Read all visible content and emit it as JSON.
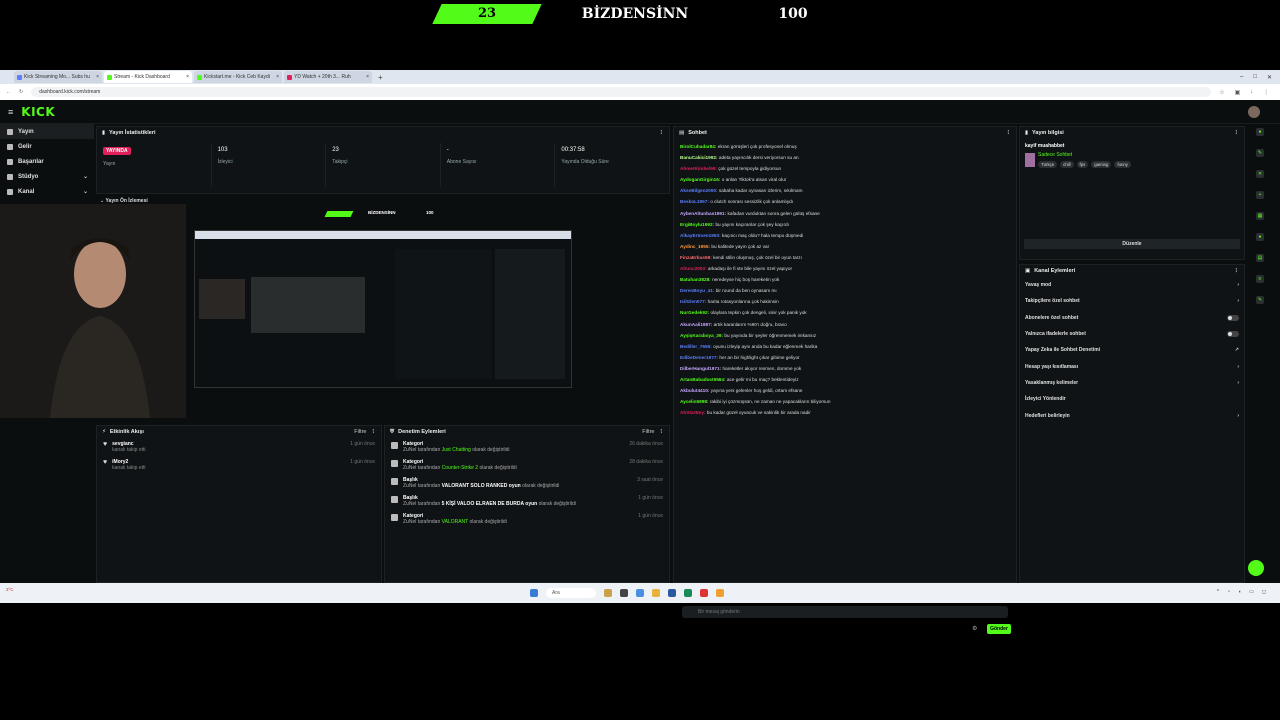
{
  "overlay": {
    "score": "23",
    "title": "BİZDENSİNN",
    "right_value": "100"
  },
  "browser": {
    "tabs": [
      {
        "label": "Kick Streaming Mo... Subs hu",
        "active": false
      },
      {
        "label": "Stream - Kick Dashboard",
        "active": true
      },
      {
        "label": "Kickstart.me - Kick Ceb Kaydi",
        "active": false
      },
      {
        "label": "YD Watch + 20th 3... Ruh",
        "active": false
      }
    ],
    "url": "dashboard.kick.com/stream"
  },
  "app": {
    "logo": "KICK",
    "sidebar": [
      {
        "label": "Yayın",
        "active": true,
        "chevron": false
      },
      {
        "label": "Gelir",
        "active": false,
        "chevron": false
      },
      {
        "label": "Başarılar",
        "active": false,
        "chevron": false
      },
      {
        "label": "Stüdyo",
        "active": false,
        "chevron": true
      },
      {
        "label": "Kanal",
        "active": false,
        "chevron": true
      }
    ],
    "stats": {
      "title": "Yayın İstatistikleri",
      "items": [
        {
          "value": "YAYINDA",
          "label": "Yayın",
          "badge": true
        },
        {
          "value": "103",
          "label": "İzleyici",
          "badge": false
        },
        {
          "value": "23",
          "label": "Takipçi",
          "badge": false
        },
        {
          "value": "-",
          "label": "Abone Sayısı",
          "badge": false
        },
        {
          "value": "00:37:58",
          "label": "Yayında Olduğu Süre",
          "badge": false
        }
      ]
    },
    "preview": {
      "title": "Yayın Ön İzlemesi",
      "mini_score": "",
      "mini_title": "BİZDENSİNN",
      "mini_right": "100"
    },
    "activity": {
      "title": "Etkinlik Akışı",
      "filter": "Filtre",
      "items": [
        {
          "name": "sevgianc",
          "sub": "kanalı takip etti",
          "time": "1 gün önce"
        },
        {
          "name": "iMory2",
          "sub": "kanalı takip etti",
          "time": "1 gün önce"
        }
      ]
    },
    "moderation": {
      "title": "Denetim Eylemleri",
      "filter": "Filtre",
      "items": [
        {
          "type": "Kategori",
          "pre": "ZuNel tarafından",
          "value": "Just Chatting",
          "post": "olarak değiştirildi",
          "time": "26 dakika önce"
        },
        {
          "type": "Kategori",
          "pre": "ZuNel tarafından",
          "value": "Counter-Strike 2",
          "post": "olarak değiştirildi",
          "time": "28 dakika önce"
        },
        {
          "type": "Başlık",
          "pre": "ZuNel tarafından",
          "value": "VALORANT SOLO RANKED oyun",
          "post": "olarak değiştirildi",
          "time": "3 saat önce"
        },
        {
          "type": "Başlık",
          "pre": "ZuNel tarafından",
          "value": "5 KİŞİ VALOO ELRAEN DE BURDA oyun",
          "post": "olarak değiştirildi",
          "time": "1 gün önce"
        },
        {
          "type": "Kategori",
          "pre": "ZuNel tarafından",
          "value": "VALORANT",
          "post": "olarak değiştirildi",
          "time": "1 gün önce"
        }
      ]
    },
    "chat": {
      "title": "Sohbet",
      "placeholder": "Bir mesaj gönderin",
      "send": "Gönder",
      "messages": [
        {
          "user": "BirolCuhadar84:",
          "text": "ekran görüşleri çok profesyonel olmuş",
          "color": "#53fc18"
        },
        {
          "user": "BanuCakici1992:",
          "text": "adeta yayıncılık dersi veriyorsun su an",
          "color": "#b6ff8a"
        },
        {
          "user": "AhmetKimbel99:",
          "text": "çok güzel tempoyla gidiyorsun",
          "color": "#e0205a"
        },
        {
          "user": "AydoganGirgin16:",
          "text": "o anları Tiktok'a atsan viral olur",
          "color": "#53fc18"
        },
        {
          "user": "AkseBilgen2000:",
          "text": "sabaha kadar oynasan izlerim, sıkılmam",
          "color": "#5b7fff"
        },
        {
          "user": "BeskoL1957:",
          "text": "o clutch sonrası sessizlik çok anlamlıydı",
          "color": "#5b7fff"
        },
        {
          "user": "AybenAltunbas1991:",
          "text": "kafadan vurduktan sonra gelen gülüş efsane",
          "color": "#c7a8ff"
        },
        {
          "user": "ErgiBoylu1992:",
          "text": "bu yayını kaçıranlar çok şey kaçırdı",
          "color": "#53fc18"
        },
        {
          "user": "AlkayErtmen1993:",
          "text": "kaçıncı maç oldu? hala tempo düşmedi",
          "color": "#5b7fff"
        },
        {
          "user": "Aydinc_1955:",
          "text": "bu kalitede yayın çok az var",
          "color": "#ff9a3c"
        },
        {
          "user": "FinzaErkus59:",
          "text": "kendi stilin oluşmuş, çok özel bir oyun tarzı",
          "color": "#ff6b6b"
        },
        {
          "user": "Altunc2003:",
          "text": "arkadaşı ile fi ste bile yayını özel yapıyor",
          "color": "#e0205a"
        },
        {
          "user": "Batuhan3828:",
          "text": "neredeyse hiç boş hareketin yok",
          "color": "#53fc18"
        },
        {
          "user": "DerenBoyu_41:",
          "text": "bir round da ben oynasam mı",
          "color": "#5b7fff"
        },
        {
          "user": "IsilGlen077:",
          "text": "harita rotasyonlarına çok hakimsin",
          "color": "#5b7fff"
        },
        {
          "user": "NurGedek92:",
          "text": "olaylara tepkin çok dengeli, sinir yok panik yok",
          "color": "#53fc18"
        },
        {
          "user": "AkunAali1987:",
          "text": "artık karanlarım %90'ı doğru, bravo",
          "color": "#c7a8ff"
        },
        {
          "user": "AyşişKaraboya_39:",
          "text": "bu yayında bir şeyler öğrenmemek imkansız",
          "color": "#53fc18"
        },
        {
          "user": "Bediller_7655:",
          "text": "oyunu izleyip aynı anda bu kadar eğlenmek harika",
          "color": "#5b7fff"
        },
        {
          "user": "EdibeDener1977:",
          "text": "her an bir highlight çıkar gibime geliyor",
          "color": "#5b7fff"
        },
        {
          "user": "DilberHangul1971:",
          "text": "hareketler akıyor resmen, domme yok",
          "color": "#c7a8ff"
        },
        {
          "user": "ArtanBabadost5564:",
          "text": "ace gelir mi bu maç? beklentideyiz",
          "color": "#53fc18"
        },
        {
          "user": "Akbulut4410:",
          "text": "yayına yeni gelenler hoş geldi, ortam efsane",
          "color": "#c7a8ff"
        },
        {
          "user": "Aycelin5898:",
          "text": "rakibi iyi çözmüşsün, ne zaman ne yapacakların biliyorsun",
          "color": "#53fc18"
        },
        {
          "user": "AhStarBey:",
          "text": "bu kadar güzel oyuncuk ve sakinlik bir arada nadir",
          "color": "#e0205a"
        }
      ]
    },
    "stream_info": {
      "title": "Yayın bilgisi",
      "streamer": "kayif muahabbet",
      "category": "Sadece Sohbet",
      "tags": [
        "Türkçe",
        "chill",
        "fps",
        "gaming",
        "funny"
      ],
      "edit": "Düzenle"
    },
    "channel_actions": {
      "title": "Kanal Eylemleri",
      "items": [
        {
          "label": "Yavaş mod",
          "control": "chevron"
        },
        {
          "label": "Takipçilere özel sohbet",
          "control": "chevron"
        },
        {
          "label": "Abonelere özel sohbet",
          "control": "toggle"
        },
        {
          "label": "Yalnızca ifadelerle sohbet",
          "control": "toggle"
        },
        {
          "label": "Yapay Zeka ile Sohbet Denetimi",
          "control": "external"
        },
        {
          "label": "Hesap yaşı kısıtlaması",
          "control": "chevron"
        },
        {
          "label": "Yasaklanmış kelimeler",
          "control": "chevron"
        },
        {
          "label": "İzleyici Yönlendir",
          "control": "none"
        },
        {
          "label": "Hedefleri belirleyin",
          "control": "chevron"
        }
      ]
    }
  },
  "taskbar": {
    "search": "Ara",
    "left_info": "3°C"
  },
  "colors": {
    "accent": "#53fc18",
    "live": "#e0205a"
  }
}
